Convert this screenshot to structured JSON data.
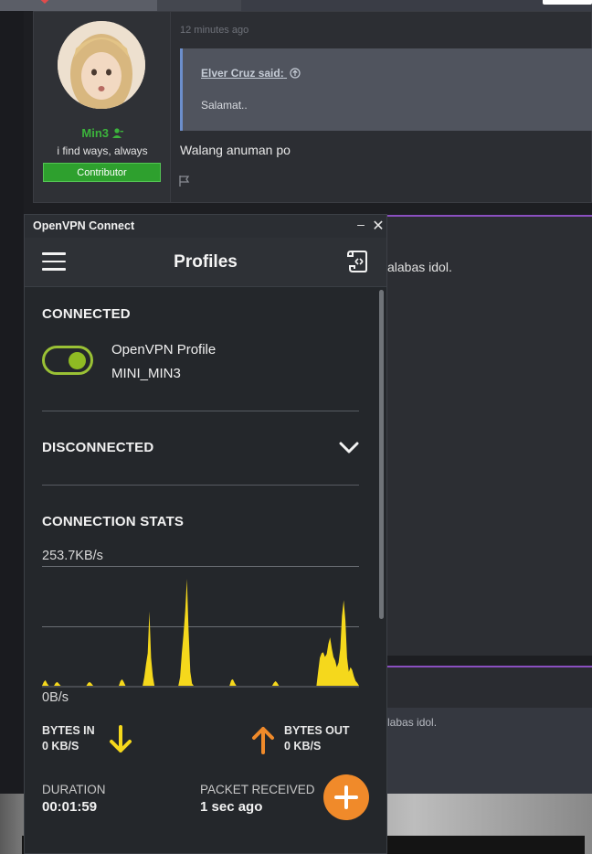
{
  "forum": {
    "post1": {
      "time": "12 minutes ago",
      "username": "Min3",
      "user_title": "i find ways, always",
      "badge": "Contributor",
      "quote_author": "Elver Cruz said:",
      "quote_text": "Salamat..",
      "body": "Walang anuman po"
    },
    "post2_snippet": "alabas idol.",
    "post3_snippet": "labas idol."
  },
  "vpn": {
    "window_title": "OpenVPN Connect",
    "minimize": "–",
    "close": "✕",
    "header_title": "Profiles",
    "connected_label": "CONNECTED",
    "profile_name": "OpenVPN Profile",
    "profile_sub": "MINI_MIN3",
    "profile_connected": true,
    "disconnected_label": "DISCONNECTED",
    "stats_label": "CONNECTION STATS",
    "rate_max": "253.7KB/s",
    "rate_min": "0B/s",
    "bytes_in_label": "BYTES IN",
    "bytes_in_value": "0 KB/S",
    "bytes_out_label": "BYTES OUT",
    "bytes_out_value": "0 KB/S",
    "duration_label": "DURATION",
    "duration_value": "00:01:59",
    "packet_label": "PACKET RECEIVED",
    "packet_value": "1 sec ago",
    "colors": {
      "accent_green": "#8fbb23",
      "traffic_yellow": "#f5d81c",
      "orange": "#f08a2a",
      "username_green": "#3cb43c"
    },
    "icons": {
      "menu": "hamburger-icon",
      "import": "import-profile-icon",
      "expand": "chevron-down-icon",
      "in": "arrow-down-icon",
      "out": "arrow-up-icon",
      "add": "plus-icon"
    }
  },
  "chart_data": {
    "type": "area",
    "title": "",
    "xlabel": "",
    "ylabel": "",
    "ylim": [
      0,
      253.7
    ],
    "unit": "KB/s",
    "series": [
      {
        "values": [
          0,
          8,
          12,
          5,
          0,
          0,
          0,
          0,
          6,
          8,
          4,
          0,
          0,
          0,
          0,
          0,
          0,
          0,
          0,
          0,
          0,
          0,
          0,
          0,
          0,
          0,
          0,
          6,
          8,
          5,
          0,
          0,
          0,
          0,
          0,
          0,
          0,
          0,
          0,
          0,
          0,
          0,
          0,
          0,
          0,
          0,
          10,
          14,
          8,
          0,
          0,
          0,
          0,
          0,
          0,
          0,
          0,
          0,
          0,
          0,
          18,
          46,
          70,
          160,
          60,
          20,
          0,
          0,
          0,
          0,
          0,
          0,
          0,
          0,
          0,
          0,
          0,
          0,
          0,
          0,
          0,
          18,
          70,
          110,
          160,
          230,
          120,
          30,
          5,
          0,
          0,
          0,
          0,
          0,
          0,
          0,
          0,
          0,
          0,
          0,
          0,
          0,
          0,
          0,
          0,
          0,
          0,
          0,
          0,
          0,
          0,
          12,
          14,
          6,
          0,
          0,
          0,
          0,
          0,
          0,
          0,
          0,
          0,
          0,
          0,
          0,
          0,
          0,
          0,
          0,
          0,
          0,
          0,
          0,
          0,
          0,
          6,
          10,
          6,
          0,
          0,
          0,
          0,
          0,
          0,
          0,
          0,
          0,
          0,
          0,
          0,
          0,
          0,
          0,
          0,
          0,
          0,
          0,
          0,
          0,
          0,
          0,
          30,
          60,
          70,
          72,
          62,
          68,
          90,
          104,
          80,
          62,
          54,
          40,
          50,
          80,
          150,
          184,
          140,
          60,
          30,
          40,
          34,
          20,
          10,
          6,
          0
        ]
      }
    ]
  }
}
